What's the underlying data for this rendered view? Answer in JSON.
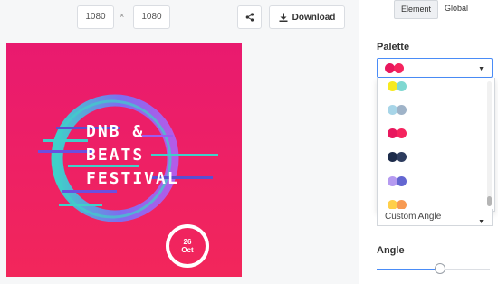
{
  "toolbar": {
    "width_value": "1080",
    "separator": "×",
    "height_value": "1080",
    "share_icon": "share-icon",
    "download_label": "Download",
    "download_icon": "download-icon"
  },
  "poster": {
    "title_lines": [
      "DNB &",
      "BEATS",
      "FESTIVAL"
    ],
    "date_day": "26",
    "date_month": "Oct",
    "colors": {
      "background": "#ed1c6b",
      "ring_cyan": "#3fd0c9",
      "ring_purple": "#9b5cf0"
    }
  },
  "panel": {
    "tabs": [
      {
        "label": "Element",
        "active": true
      },
      {
        "label": "Global",
        "active": false
      }
    ],
    "palette_label": "Palette",
    "palette_selected": [
      "#e8175d",
      "#f5245e"
    ],
    "palette_options": [
      [
        "#f7ea1f",
        "#7fd8d1"
      ],
      [
        "#a7d5e8",
        "#9fb3c8"
      ],
      [
        "#e8175d",
        "#f5245e"
      ],
      [
        "#1c2b4a",
        "#2d3c5e"
      ],
      [
        "#b59af0",
        "#6366d1"
      ],
      [
        "#ffcf4a",
        "#f79a52"
      ]
    ],
    "angle_select_value": "Custom Angle",
    "angle_label": "Angle",
    "angle_fraction": 0.56
  }
}
